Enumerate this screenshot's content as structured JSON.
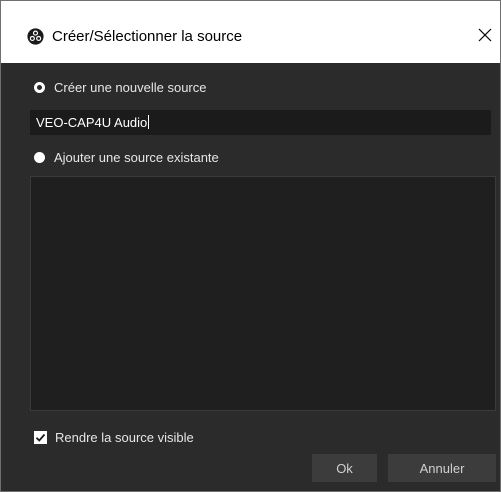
{
  "window": {
    "title": "Créer/Sélectionner la source",
    "icon": "obs-logo-icon",
    "close_label": "✕"
  },
  "options": {
    "create_new_label": "Créer une nouvelle source",
    "create_new_selected": true,
    "add_existing_label": "Ajouter une source existante",
    "add_existing_selected": false
  },
  "name_input": {
    "value": "VEO-CAP4U Audio"
  },
  "existing_sources": [],
  "visible_checkbox": {
    "label": "Rendre la source visible",
    "checked": true
  },
  "buttons": {
    "ok_label": "Ok",
    "cancel_label": "Annuler"
  },
  "colors": {
    "background": "#2b2b2b",
    "input_background": "#1b1b1b",
    "list_background": "#1f1f1f",
    "button_background": "#3c3c3c",
    "titlebar": "#ffffff"
  }
}
